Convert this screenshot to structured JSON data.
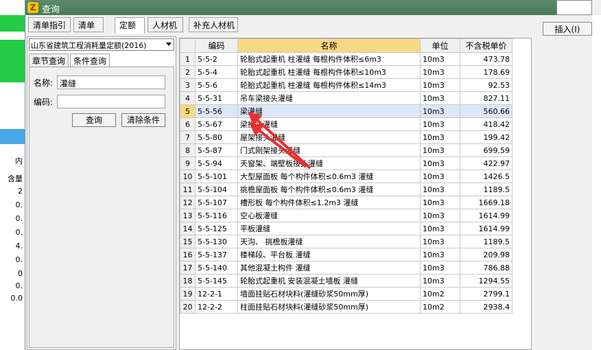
{
  "window": {
    "title": "查询",
    "insert_label": "插入(I)"
  },
  "tabs": [
    "清单指引",
    "清单",
    "定额",
    "人材机",
    "补充人材机"
  ],
  "active_tab": "定额",
  "left": {
    "dropdown_value": "山东省建筑工程消耗量定额(2016)",
    "subtabs": [
      "章节查询",
      "条件查询"
    ],
    "name_label": "名称:",
    "name_value": "灌缝",
    "code_label": "编码:",
    "code_value": "",
    "query_label": "查询",
    "clear_label": "清除条件"
  },
  "background": {
    "left_texts": [
      "内",
      "含量",
      "2",
      "0.",
      "0.",
      "0.",
      "4.",
      "0.",
      "0",
      "0.",
      "0.0"
    ]
  },
  "table": {
    "headers": [
      "",
      "编码",
      "名称",
      "单位",
      "不含税单价"
    ],
    "selected_row": 5,
    "rows": [
      [
        "1",
        "5-5-2",
        "轮胎式起重机 柱灌缝 每根构件体积≤6m3",
        "10m3",
        "473.78"
      ],
      [
        "2",
        "5-5-4",
        "轮胎式起重机 柱灌缝 每根构件体积≤10m3",
        "10m3",
        "178.69"
      ],
      [
        "3",
        "5-5-6",
        "轮胎式起重机 柱灌缝 每根构件体积≤14m3",
        "10m3",
        "92.53"
      ],
      [
        "4",
        "5-5-31",
        "吊车梁接头灌缝",
        "10m3",
        "827.11"
      ],
      [
        "5",
        "5-5-56",
        "梁灌缝",
        "10m3",
        "560.66"
      ],
      [
        "6",
        "5-5-67",
        "梁接头灌缝",
        "10m3",
        "418.42"
      ],
      [
        "7",
        "5-5-80",
        "屋架接头灌缝",
        "10m3",
        "199.42"
      ],
      [
        "8",
        "5-5-87",
        "门式刚架接头灌缝",
        "10m3",
        "699.59"
      ],
      [
        "9",
        "5-5-94",
        "天窗架、端壁板接头灌缝",
        "10m3",
        "422.97"
      ],
      [
        "10",
        "5-5-101",
        "大型屋面板 每个构件体积≤0.6m3 灌缝",
        "10m3",
        "1426.5"
      ],
      [
        "11",
        "5-5-104",
        "挑檐屋面板 每个构件体积≤0.6m3 灌缝",
        "10m3",
        "1189.5"
      ],
      [
        "12",
        "5-5-107",
        "槽形板 每个构件体积≤1.2m3 灌缝",
        "10m3",
        "1669.18"
      ],
      [
        "13",
        "5-5-116",
        "空心板灌缝",
        "10m3",
        "1614.99"
      ],
      [
        "14",
        "5-5-125",
        "平板灌缝",
        "10m3",
        "1614.99"
      ],
      [
        "15",
        "5-5-130",
        "天沟、 挑檐板灌缝",
        "10m3",
        "1189.5"
      ],
      [
        "16",
        "5-5-137",
        "楼梯段、平台板 灌缝",
        "10m3",
        "209.98"
      ],
      [
        "17",
        "5-5-140",
        "其他混凝土构件 灌缝",
        "10m3",
        "786.88"
      ],
      [
        "18",
        "5-5-145",
        "轮胎式起重机 安装混凝土墙板 灌缝",
        "10m3",
        "1294.55"
      ],
      [
        "19",
        "12-2-1",
        "墙面挂贴石材块料(灌缝砂浆50mm厚)",
        "10m2",
        "2799.1"
      ],
      [
        "20",
        "12-2-2",
        "柱面挂贴石材块料(灌缝砂浆50mm厚)",
        "10m2",
        "2938.4"
      ]
    ]
  },
  "colors": {
    "arrow": "#e83030",
    "header_highlight": "#f8d880",
    "selection": "#dce8f8"
  }
}
